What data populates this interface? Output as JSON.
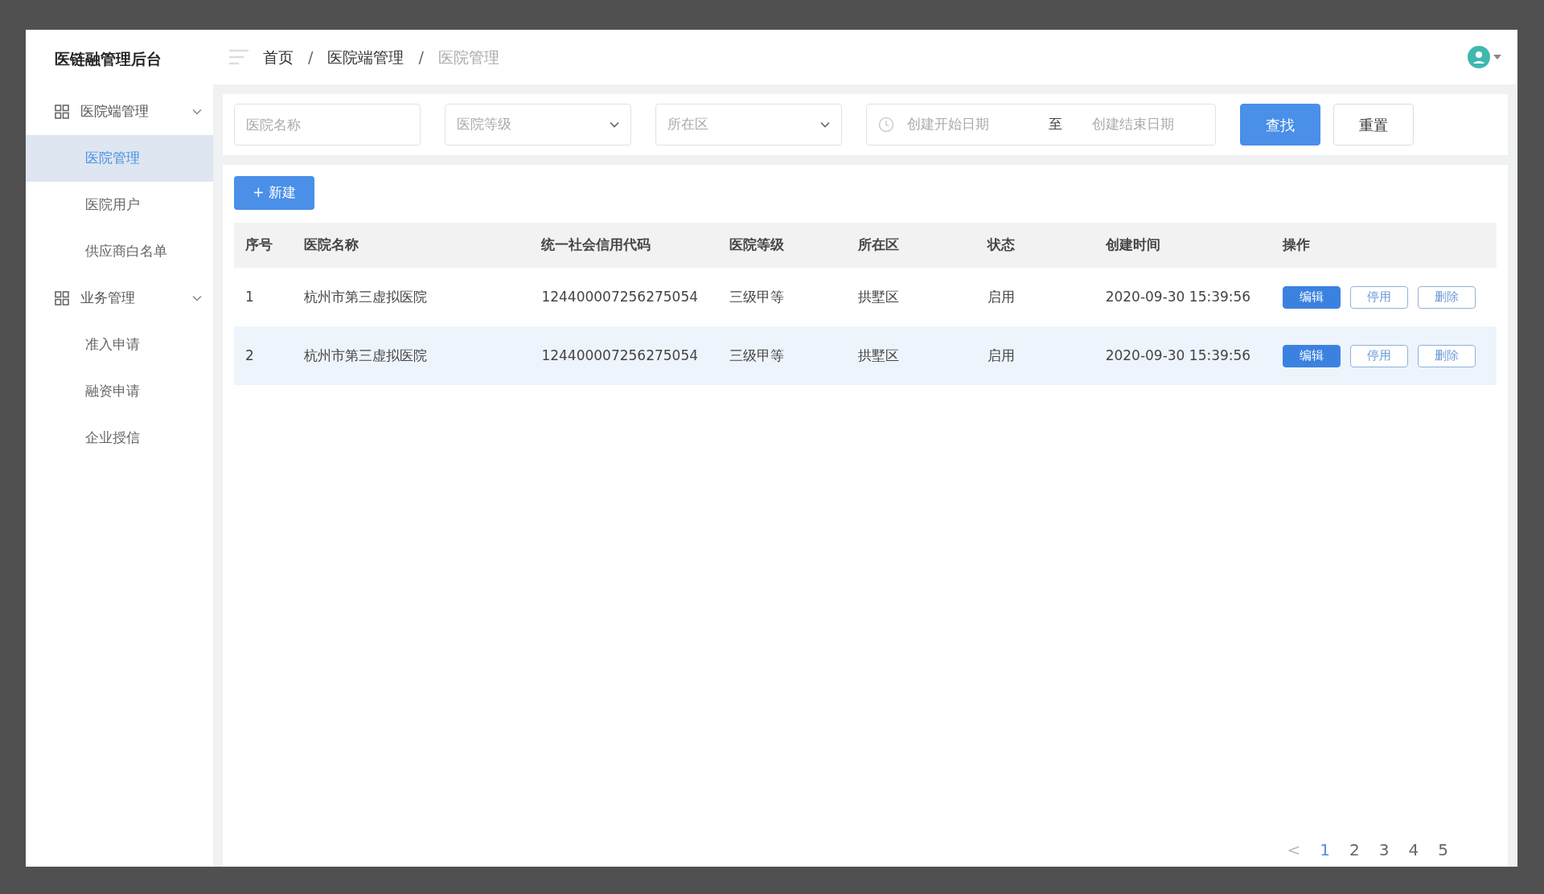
{
  "brand": "医链融管理后台",
  "sidebar": [
    {
      "label": "医院端管理",
      "expanded": true,
      "children": [
        {
          "label": "医院管理",
          "selected": true
        },
        {
          "label": "医院用户",
          "selected": false
        },
        {
          "label": "供应商白名单",
          "selected": false
        }
      ]
    },
    {
      "label": "业务管理",
      "expanded": true,
      "children": [
        {
          "label": "准入申请",
          "selected": false
        },
        {
          "label": "融资申请",
          "selected": false
        },
        {
          "label": "企业授信",
          "selected": false
        }
      ]
    }
  ],
  "breadcrumb": {
    "separator": "/",
    "items": [
      "首页",
      "医院端管理",
      "医院管理"
    ]
  },
  "filters": {
    "name": {
      "placeholder": "医院名称"
    },
    "grade": {
      "placeholder": "医院等级"
    },
    "district": {
      "placeholder": "所在区"
    },
    "date_range": {
      "start_placeholder": "创建开始日期",
      "separator": "至",
      "end_placeholder": "创建结束日期"
    },
    "buttons": [
      {
        "label": "查找",
        "kind": "primary"
      },
      {
        "label": "重置",
        "kind": "plain"
      }
    ]
  },
  "new_button": {
    "icon": "+",
    "label": "新建"
  },
  "table": {
    "columns": [
      "序号",
      "医院名称",
      "统一社会信用代码",
      "医院等级",
      "所在区",
      "状态",
      "创建时间",
      "操作"
    ],
    "rows": [
      {
        "selected": false,
        "cells": [
          "1",
          "杭州市第三虚拟医院",
          "124400007256275054",
          "三级甲等",
          "拱墅区",
          "启用",
          "2020-09-30 15:39:56"
        ],
        "actions": [
          {
            "label": "编辑",
            "kind": "primary"
          },
          {
            "label": "停用",
            "kind": "plain"
          },
          {
            "label": "删除",
            "kind": "plain"
          }
        ]
      },
      {
        "selected": true,
        "cells": [
          "2",
          "杭州市第三虚拟医院",
          "124400007256275054",
          "三级甲等",
          "拱墅区",
          "启用",
          "2020-09-30 15:39:56"
        ],
        "actions": [
          {
            "label": "编辑",
            "kind": "primary"
          },
          {
            "label": "停用",
            "kind": "plain"
          },
          {
            "label": "删除",
            "kind": "plain"
          }
        ]
      }
    ]
  },
  "pagination": {
    "prev": "<",
    "pages": [
      {
        "label": "1",
        "selected": true
      },
      {
        "label": "2",
        "selected": false
      },
      {
        "label": "3",
        "selected": false
      },
      {
        "label": "4",
        "selected": false
      },
      {
        "label": "5",
        "selected": false
      }
    ]
  }
}
